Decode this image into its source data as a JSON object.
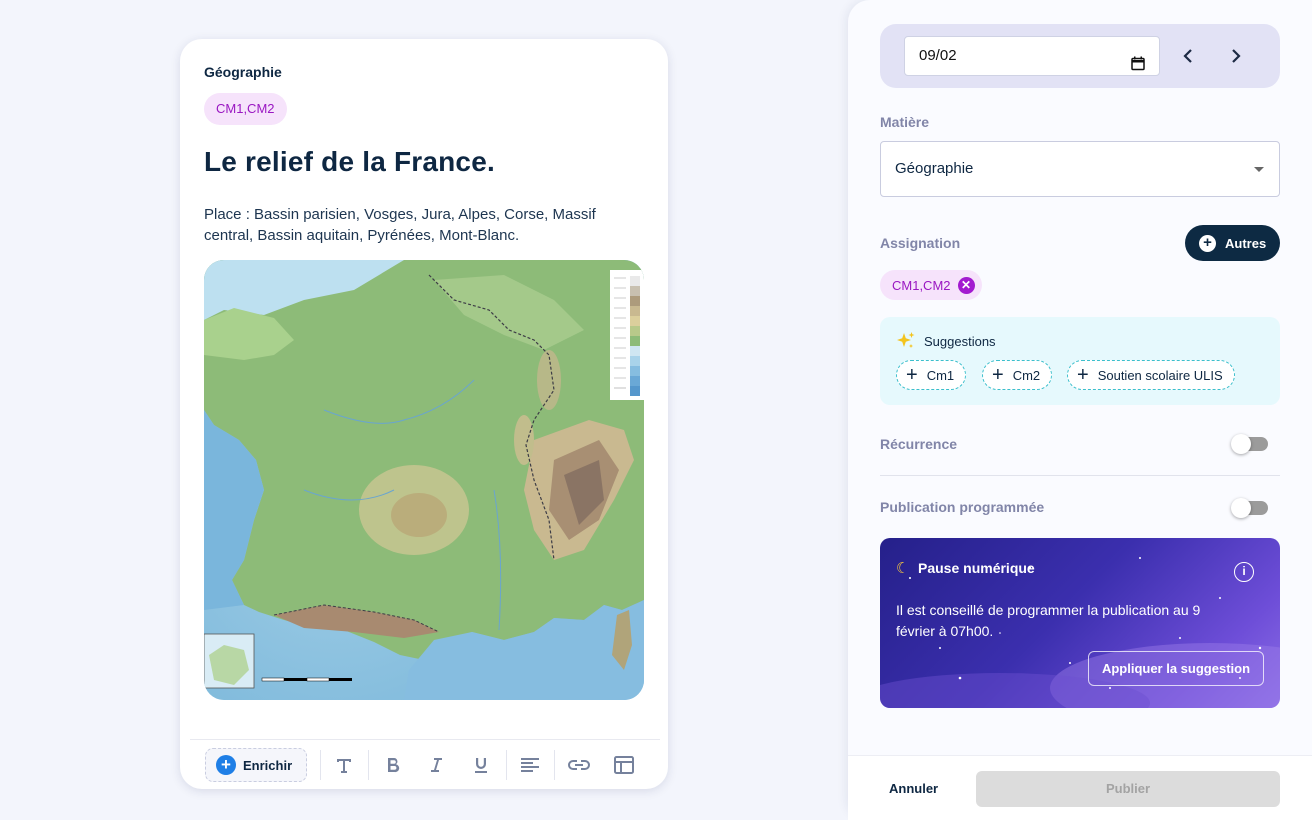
{
  "editor": {
    "subject": "Géographie",
    "level_tag": "CM1,CM2",
    "title": "Le relief de la France.",
    "description": "Place : Bassin parisien, Vosges, Jura, Alpes, Corse, Massif central, Bassin aquitain, Pyrénées, Mont-Blanc.",
    "toolbar": {
      "enrich_label": "Enrichir",
      "tools": [
        "text-size-icon",
        "bold-icon",
        "italic-icon",
        "underline-icon",
        "align-icon",
        "link-icon",
        "table-icon"
      ]
    }
  },
  "panel": {
    "date_value": "09/02",
    "matiere_label": "Matière",
    "matiere_value": "Géographie",
    "assignation_label": "Assignation",
    "autres_label": "Autres",
    "assigned_tag": "CM1,CM2",
    "suggestions": {
      "title": "Suggestions",
      "chips": [
        "Cm1",
        "Cm2",
        "Soutien scolaire ULIS"
      ]
    },
    "recurrence_label": "Récurrence",
    "recurrence_on": false,
    "publication_label": "Publication programmée",
    "publication_on": false,
    "pause": {
      "title": "Pause numérique",
      "text": "Il est conseillé de programmer la publication au 9 février à 07h00.",
      "button": "Appliquer la suggestion"
    },
    "footer": {
      "cancel": "Annuler",
      "publish": "Publier"
    }
  },
  "colors": {
    "accent_purple": "#9a17c2",
    "navy": "#0d2a43",
    "suggestion_bg": "#e6f9fd"
  }
}
